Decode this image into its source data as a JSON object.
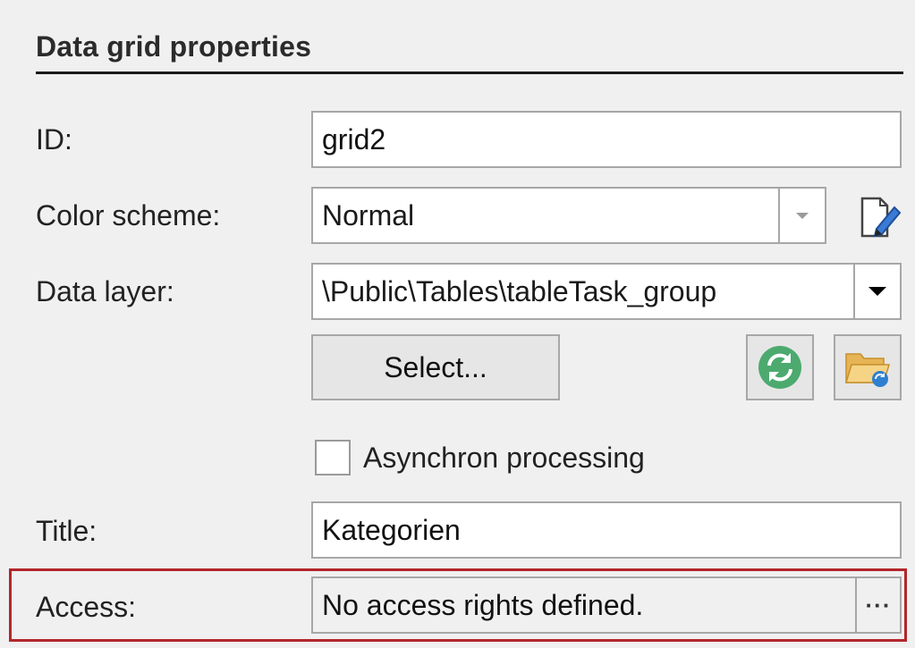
{
  "section": {
    "title": "Data grid properties"
  },
  "id_field": {
    "label": "ID:",
    "value": "grid2"
  },
  "color_scheme": {
    "label": "Color scheme:",
    "value": "Normal",
    "edit_icon": "edit-document-pencil-icon"
  },
  "data_layer": {
    "label": "Data layer:",
    "value": "\\Public\\Tables\\tableTask_group",
    "select_label": "Select...",
    "refresh_icon": "refresh-icon",
    "open_folder_icon": "open-folder-icon"
  },
  "async": {
    "label": "Asynchron processing",
    "checked": false
  },
  "title_field": {
    "label": "Title:",
    "value": "Kategorien"
  },
  "access": {
    "label": "Access:",
    "value": "No access rights defined.",
    "ellipsis": "···"
  },
  "colors": {
    "highlight_border": "#b2262a",
    "refresh_green": "#4caa6f",
    "folder_yellow": "#f0c770"
  }
}
